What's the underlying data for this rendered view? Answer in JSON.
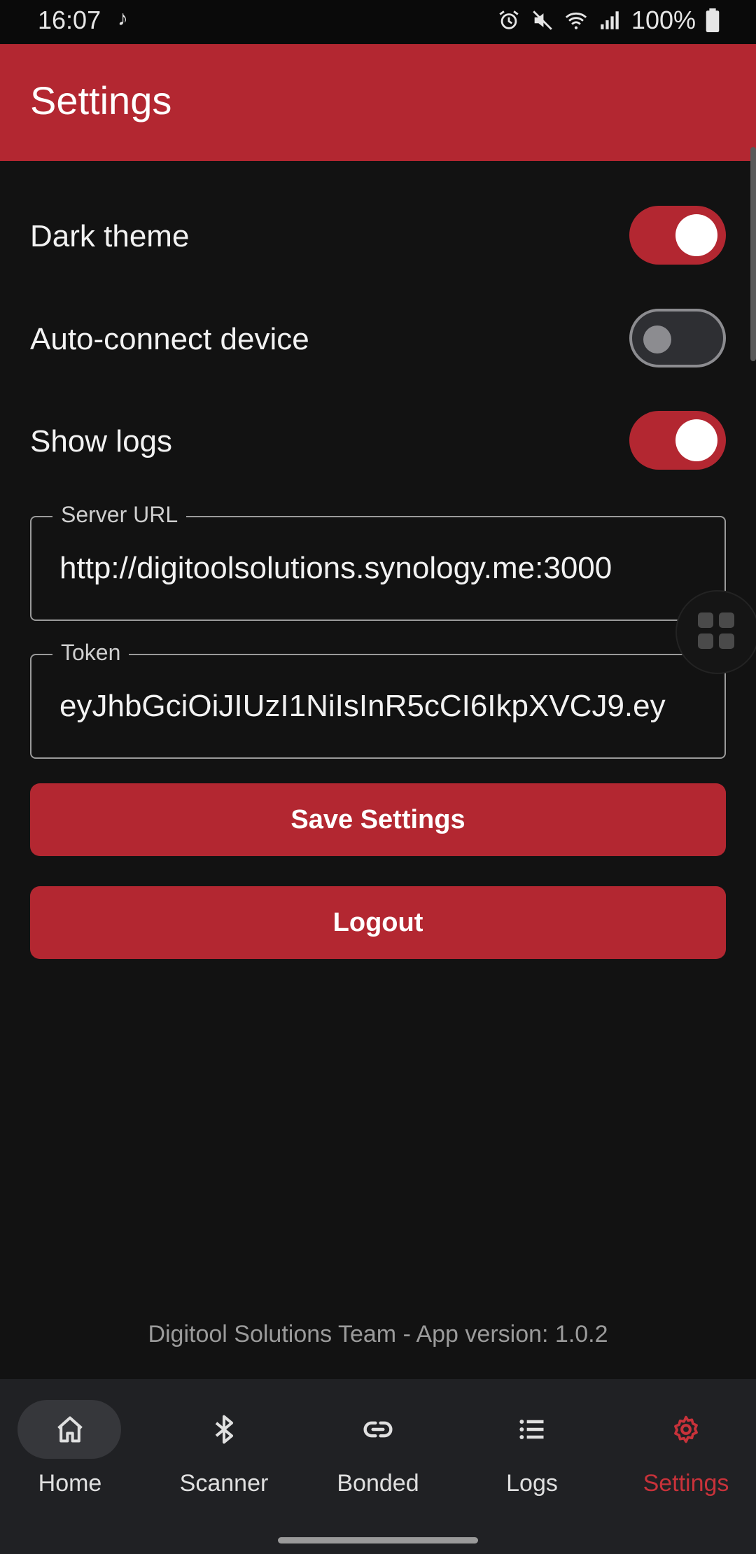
{
  "status_bar": {
    "time": "16:07",
    "battery": "100%"
  },
  "app_bar": {
    "title": "Settings"
  },
  "settings": {
    "dark_theme": {
      "label": "Dark theme",
      "enabled": true
    },
    "auto_connect": {
      "label": "Auto-connect device",
      "enabled": false
    },
    "show_logs": {
      "label": "Show logs",
      "enabled": true
    }
  },
  "fields": {
    "server_url": {
      "label": "Server URL",
      "value": "http://digitoolsolutions.synology.me:3000"
    },
    "token": {
      "label": "Token",
      "value": "eyJhbGciOiJIUzI1NiIsInR5cCI6IkpXVCJ9.ey"
    }
  },
  "buttons": {
    "save": "Save Settings",
    "logout": "Logout"
  },
  "footer": {
    "text": "Digitool Solutions Team - App version: 1.0.2"
  },
  "nav": {
    "items": [
      {
        "label": "Home",
        "icon": "home-icon"
      },
      {
        "label": "Scanner",
        "icon": "bluetooth-icon"
      },
      {
        "label": "Bonded",
        "icon": "link-icon"
      },
      {
        "label": "Logs",
        "icon": "list-icon"
      },
      {
        "label": "Settings",
        "icon": "gear-icon",
        "active": true
      }
    ]
  },
  "colors": {
    "accent": "#b32731",
    "background": "#121212",
    "nav_bg": "#202124"
  }
}
